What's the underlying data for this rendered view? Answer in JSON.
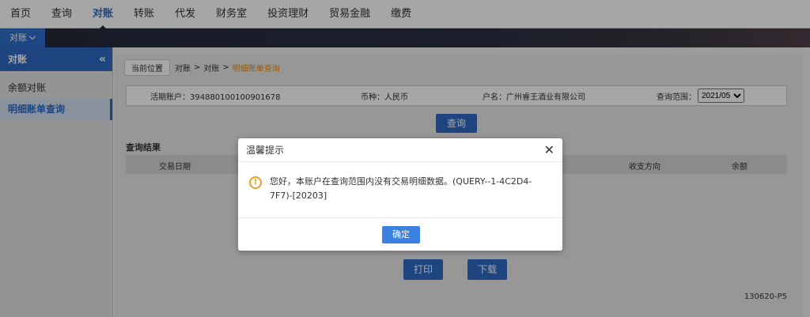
{
  "topnav": {
    "items": [
      "首页",
      "查询",
      "对账",
      "转账",
      "代发",
      "财务室",
      "投资理财",
      "贸易金融",
      "缴费"
    ],
    "active_index": 2
  },
  "subbar": {
    "tab_label": "对账"
  },
  "sidebar": {
    "title": "对账",
    "items": [
      {
        "label": "余额对账",
        "active": false
      },
      {
        "label": "明细账单查询",
        "active": true
      }
    ]
  },
  "breadcrumb": {
    "label": "当前位置",
    "parts": [
      "对账",
      "对账",
      "明细账单查询"
    ]
  },
  "info": {
    "account_label": "活期账户：",
    "account_value": "394880100100901678",
    "currency_label": "币种：",
    "currency_value": "人民币",
    "name_label": "户名：",
    "name_value": "广州睿王酒业有限公司",
    "range_label": "查询范围：",
    "range_value": "2021/05"
  },
  "buttons": {
    "query": "查询",
    "print": "打印",
    "download": "下载"
  },
  "results": {
    "title": "查询结果",
    "columns": [
      "交易日期",
      "收支方向",
      "余额"
    ]
  },
  "page_code": "130620-P5",
  "dialog": {
    "title": "温馨提示",
    "message": "您好，本账户在查询范围内没有交易明细数据。(QUERY--1-4C2D4-7F7)-[20203]",
    "ok": "确定"
  },
  "colors": {
    "accent": "#2e6ac5",
    "warning": "#f0a020"
  }
}
